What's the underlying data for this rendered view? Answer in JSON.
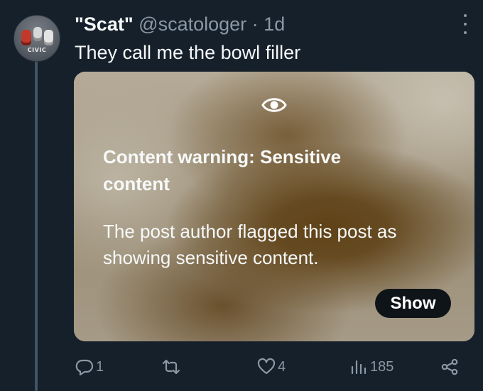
{
  "post": {
    "display_name": "\"Scat\"",
    "handle": "@scatologer",
    "separator": "·",
    "time": "1d",
    "text": "They call me the bowl filler",
    "avatar_text": "CIVIC"
  },
  "media": {
    "warning_icon": "eye-icon",
    "warning_title": "Content warning: Sensitive content",
    "warning_body": "The post author flagged this post as showing sensitive content.",
    "show_label": "Show"
  },
  "actions": {
    "reply_count": "1",
    "repost_count": "",
    "like_count": "4",
    "views_count": "185"
  },
  "colors": {
    "background": "#15202b",
    "text": "#f7f9f9",
    "secondary": "#8b98a5",
    "show_button": "#0f1419"
  }
}
